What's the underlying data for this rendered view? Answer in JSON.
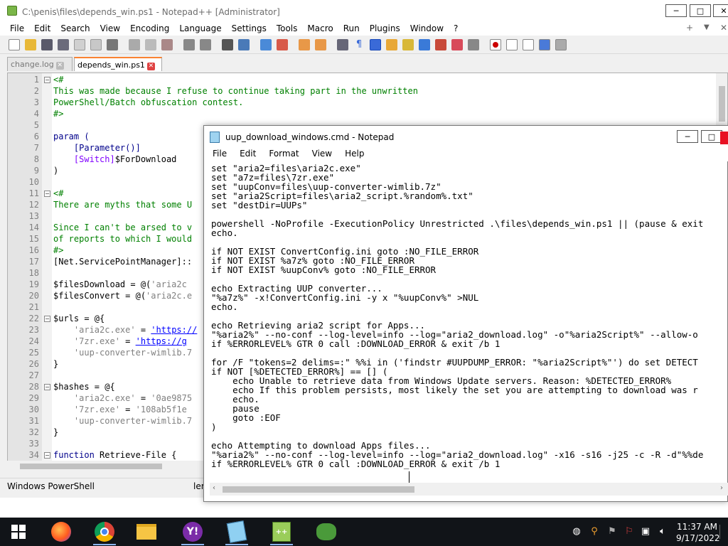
{
  "npp": {
    "title": "C:\\penis\\files\\depends_win.ps1 - Notepad++ [Administrator]",
    "menu": [
      "File",
      "Edit",
      "Search",
      "View",
      "Encoding",
      "Language",
      "Settings",
      "Tools",
      "Macro",
      "Run",
      "Plugins",
      "Window",
      "?"
    ],
    "menu_right": {
      "plus": "+",
      "down": "▼",
      "close": "✕"
    },
    "tabs": [
      {
        "label": "change.log",
        "active": false
      },
      {
        "label": "depends_win.ps1",
        "active": true
      }
    ],
    "lines": [
      {
        "n": "1",
        "segs": [
          {
            "t": "<#",
            "c": "c-cm"
          }
        ],
        "fold": "−"
      },
      {
        "n": "2",
        "segs": [
          {
            "t": "This was made because I refuse to continue taking part in the unwritten",
            "c": "c-cm"
          }
        ]
      },
      {
        "n": "3",
        "segs": [
          {
            "t": "PowerShell/Batch obfuscation contest.",
            "c": "c-cm"
          }
        ]
      },
      {
        "n": "4",
        "segs": [
          {
            "t": "#>",
            "c": "c-cm"
          }
        ]
      },
      {
        "n": "5",
        "segs": [
          {
            "t": "",
            "c": ""
          }
        ]
      },
      {
        "n": "6",
        "segs": [
          {
            "t": "param (",
            "c": "c-kw"
          }
        ]
      },
      {
        "n": "7",
        "segs": [
          {
            "t": "    ",
            "c": ""
          },
          {
            "t": "[Parameter()]",
            "c": "c-kw"
          }
        ]
      },
      {
        "n": "8",
        "segs": [
          {
            "t": "    ",
            "c": ""
          },
          {
            "t": "[Switch]",
            "c": "c-ty"
          },
          {
            "t": "$ForDownload",
            "c": ""
          }
        ]
      },
      {
        "n": "9",
        "segs": [
          {
            "t": ")",
            "c": ""
          }
        ]
      },
      {
        "n": "10",
        "segs": [
          {
            "t": "",
            "c": ""
          }
        ]
      },
      {
        "n": "11",
        "segs": [
          {
            "t": "<#",
            "c": "c-cm"
          }
        ],
        "fold": "−"
      },
      {
        "n": "12",
        "segs": [
          {
            "t": "There are myths that some U",
            "c": "c-cm"
          }
        ]
      },
      {
        "n": "13",
        "segs": [
          {
            "t": "",
            "c": ""
          }
        ]
      },
      {
        "n": "14",
        "segs": [
          {
            "t": "Since I can't be arsed to v",
            "c": "c-cm"
          }
        ]
      },
      {
        "n": "15",
        "segs": [
          {
            "t": "of reports to which I would",
            "c": "c-cm"
          }
        ]
      },
      {
        "n": "16",
        "segs": [
          {
            "t": "#>",
            "c": "c-cm"
          }
        ]
      },
      {
        "n": "17",
        "segs": [
          {
            "t": "[Net.ServicePointManager]::",
            "c": ""
          }
        ]
      },
      {
        "n": "18",
        "segs": [
          {
            "t": "",
            "c": ""
          }
        ]
      },
      {
        "n": "19",
        "segs": [
          {
            "t": "$filesDownload",
            "c": ""
          },
          {
            "t": " = @(",
            "c": ""
          },
          {
            "t": "'aria2c",
            "c": "c-str"
          }
        ]
      },
      {
        "n": "20",
        "segs": [
          {
            "t": "$filesConvert",
            "c": ""
          },
          {
            "t": " = @(",
            "c": ""
          },
          {
            "t": "'aria2c.e",
            "c": "c-str"
          }
        ]
      },
      {
        "n": "21",
        "segs": [
          {
            "t": "",
            "c": ""
          }
        ]
      },
      {
        "n": "22",
        "segs": [
          {
            "t": "$urls",
            "c": ""
          },
          {
            "t": " = @{",
            "c": ""
          }
        ],
        "fold": "−"
      },
      {
        "n": "23",
        "segs": [
          {
            "t": "    ",
            "c": ""
          },
          {
            "t": "'aria2c.exe'",
            "c": "c-str"
          },
          {
            "t": " = ",
            "c": ""
          },
          {
            "t": "'https://",
            "c": "c-url"
          }
        ]
      },
      {
        "n": "24",
        "segs": [
          {
            "t": "    ",
            "c": ""
          },
          {
            "t": "'7zr.exe'",
            "c": "c-str"
          },
          {
            "t": " = ",
            "c": ""
          },
          {
            "t": "'https://g",
            "c": "c-url"
          }
        ]
      },
      {
        "n": "25",
        "segs": [
          {
            "t": "    ",
            "c": ""
          },
          {
            "t": "'uup-converter-wimlib.7",
            "c": "c-str"
          }
        ]
      },
      {
        "n": "26",
        "segs": [
          {
            "t": "}",
            "c": ""
          }
        ]
      },
      {
        "n": "27",
        "segs": [
          {
            "t": "",
            "c": ""
          }
        ]
      },
      {
        "n": "28",
        "segs": [
          {
            "t": "$hashes",
            "c": ""
          },
          {
            "t": " = @{",
            "c": ""
          }
        ],
        "fold": "−"
      },
      {
        "n": "29",
        "segs": [
          {
            "t": "    ",
            "c": ""
          },
          {
            "t": "'aria2c.exe'",
            "c": "c-str"
          },
          {
            "t": " = ",
            "c": ""
          },
          {
            "t": "'0ae9875",
            "c": "c-str"
          }
        ]
      },
      {
        "n": "30",
        "segs": [
          {
            "t": "    ",
            "c": ""
          },
          {
            "t": "'7zr.exe'",
            "c": "c-str"
          },
          {
            "t": " = ",
            "c": ""
          },
          {
            "t": "'108ab5f1e",
            "c": "c-str"
          }
        ]
      },
      {
        "n": "31",
        "segs": [
          {
            "t": "    ",
            "c": ""
          },
          {
            "t": "'uup-converter-wimlib.7",
            "c": "c-str"
          }
        ]
      },
      {
        "n": "32",
        "segs": [
          {
            "t": "}",
            "c": ""
          }
        ]
      },
      {
        "n": "33",
        "segs": [
          {
            "t": "",
            "c": ""
          }
        ]
      },
      {
        "n": "34",
        "segs": [
          {
            "t": "function",
            "c": "c-kw"
          },
          {
            "t": " Retrieve-File {",
            "c": ""
          }
        ],
        "fold": "−"
      }
    ],
    "status": {
      "language": "Windows PowerShell",
      "length": "ler"
    }
  },
  "notepad": {
    "title": "uup_download_windows.cmd - Notepad",
    "menu": [
      "File",
      "Edit",
      "Format",
      "View",
      "Help"
    ],
    "lines": [
      "set \"aria2=files\\aria2c.exe\"",
      "set \"a7z=files\\7zr.exe\"",
      "set \"uupConv=files\\uup-converter-wimlib.7z\"",
      "set \"aria2Script=files\\aria2_script.%random%.txt\"",
      "set \"destDir=UUPs\"",
      "",
      "powershell -NoProfile -ExecutionPolicy Unrestricted .\\files\\depends_win.ps1 || (pause & exit",
      "echo.",
      "",
      "if NOT EXIST ConvertConfig.ini goto :NO_FILE_ERROR",
      "if NOT EXIST %a7z% goto :NO_FILE_ERROR",
      "if NOT EXIST %uupConv% goto :NO_FILE_ERROR",
      "",
      "echo Extracting UUP converter...",
      "\"%a7z%\" -x!ConvertConfig.ini -y x \"%uupConv%\" >NUL",
      "echo.",
      "",
      "echo Retrieving aria2 script for Apps...",
      "\"%aria2%\" --no-conf --log-level=info --log=\"aria2_download.log\" -o\"%aria2Script%\" --allow-o",
      "if %ERRORLEVEL% GTR 0 call :DOWNLOAD_ERROR & exit /b 1",
      "",
      "for /F \"tokens=2 delims=:\" %%i in ('findstr #UUPDUMP_ERROR: \"%aria2Script%\"') do set DETECT",
      "if NOT [%DETECTED_ERROR%] == [] (",
      "    echo Unable to retrieve data from Windows Update servers. Reason: %DETECTED_ERROR%",
      "    echo If this problem persists, most likely the set you are attempting to download was r",
      "    echo.",
      "    pause",
      "    goto :EOF",
      ")",
      "",
      "echo Attempting to download Apps files...",
      "\"%aria2%\" --no-conf --log-level=info --log=\"aria2_download.log\" -x16 -s16 -j25 -c -R -d\"%%de",
      "if %ERRORLEVEL% GTR 0 call :DOWNLOAD_ERROR & exit /b 1"
    ]
  },
  "taskbar": {
    "clock_time": "11:37 AM",
    "clock_date": "9/17/2022",
    "apps": [
      "start",
      "firefox",
      "chrome",
      "file-explorer",
      "yahoo-messenger",
      "notepad",
      "notepad-plus-plus",
      "gecko"
    ]
  }
}
